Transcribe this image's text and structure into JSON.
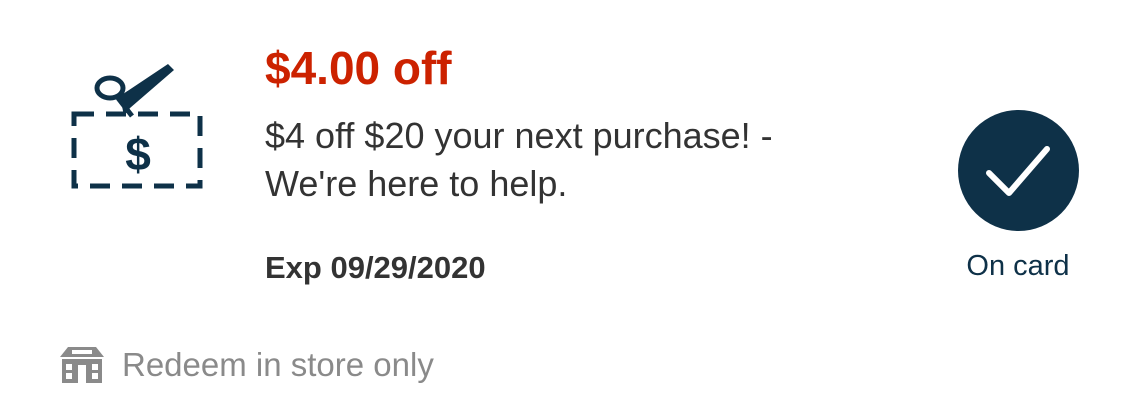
{
  "colors": {
    "accent_red": "#cc2200",
    "brand_navy": "#0e3148",
    "muted_gray": "#8a8a8a"
  },
  "coupon": {
    "icon": "coupon-scissors-dollar-icon",
    "icon_glyph": "$",
    "title": "$4.00 off",
    "description_line1": "$4 off $20 your next purchase! -",
    "description_line2": "We're here to help.",
    "expiry": "Exp 09/29/2020"
  },
  "status": {
    "icon": "checkmark-icon",
    "label": "On card"
  },
  "redeem": {
    "icon": "store-icon",
    "text": "Redeem in store only"
  }
}
